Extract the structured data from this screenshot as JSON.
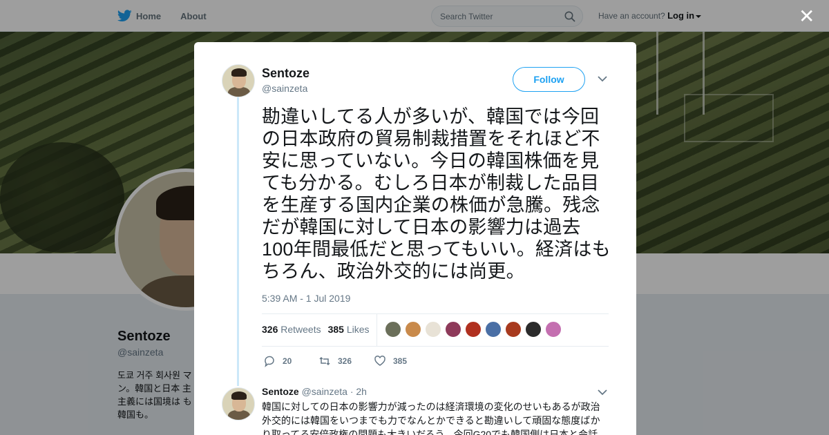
{
  "nav": {
    "home_label": "Home",
    "about_label": "About",
    "search_placeholder": "Search Twitter",
    "account_prompt": "Have an account?",
    "login_label": "Log in"
  },
  "profile": {
    "name": "Sentoze",
    "handle": "@sainzeta",
    "bio": "도쿄 거주 회사원 マン。韓国と日本 主主義には国境は も韓国も。"
  },
  "tweet": {
    "author_name": "Sentoze",
    "author_handle": "@sainzeta",
    "follow_label": "Follow",
    "text": "勘違いしてる人が多いが、韓国では今回の日本政府の貿易制裁措置をそれほど不安に思っていない。今日の韓国株価を見ても分かる。むしろ日本が制裁した品目を生産する国内企業の株価が急騰。残念だが韓国に対して日本の影響力は過去100年間最低だと思ってもいい。経済はもちろん、政治外交的には尚更。",
    "timestamp": "5:39 AM - 1 Jul 2019",
    "retweets_count": "326",
    "retweets_label": "Retweets",
    "likes_count": "385",
    "likes_label": "Likes",
    "reply_action_count": "20",
    "retweet_action_count": "326",
    "like_action_count": "385",
    "liker_colors": [
      "#6b6f5a",
      "#c98a4b",
      "#e8e2d6",
      "#8e3a5a",
      "#b0301f",
      "#4a6fa5",
      "#a83a1e",
      "#2b2b2b",
      "#c46fb0"
    ]
  },
  "reply": {
    "author_name": "Sentoze",
    "author_handle": "@sainzeta",
    "age": "· 2h",
    "text": "韓国に対しての日本の影響力が減ったのは経済環境の変化のせいもあるが政治外交的には韓国をいつまでも力でなんとかできると勘違いして頑固な態度ばかり取ってる安倍政権の問題も大きいだろう。今回G20でも韓国側は日本と会話"
  }
}
